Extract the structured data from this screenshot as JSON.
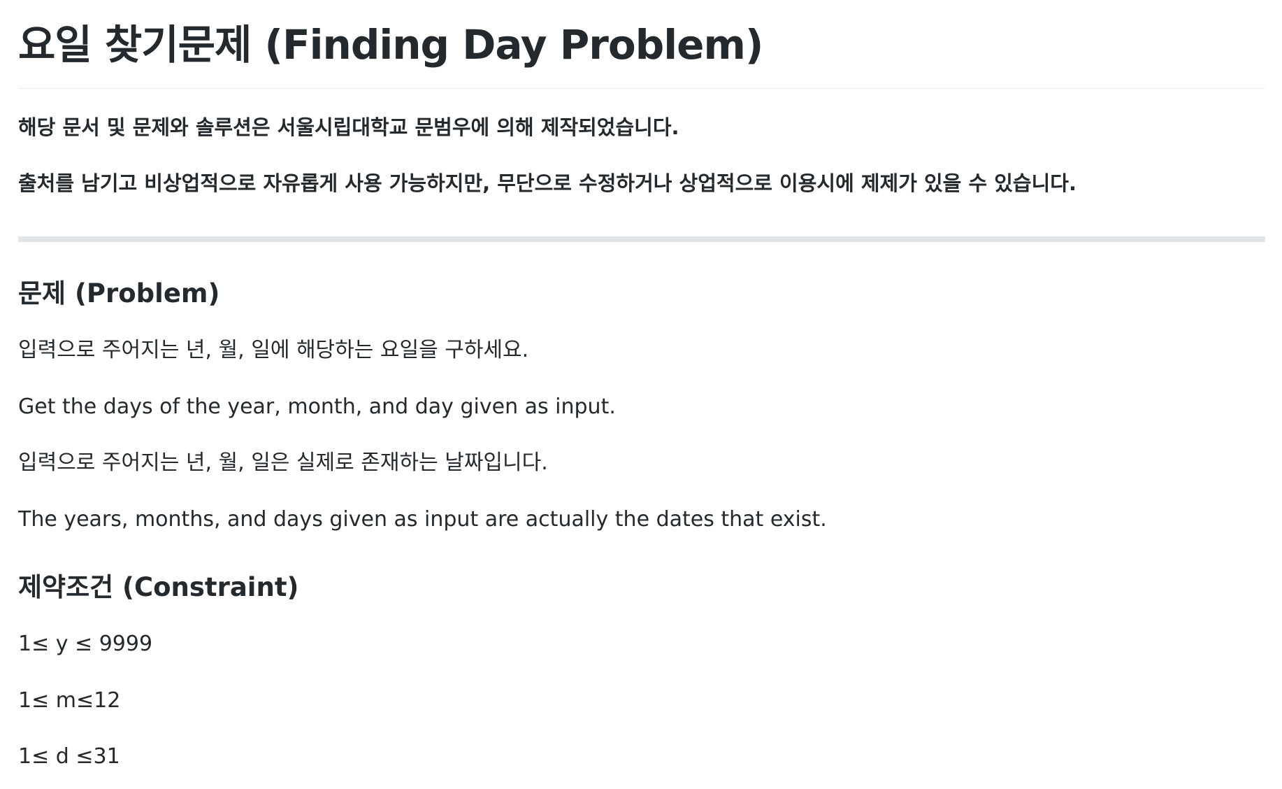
{
  "title": "요일 찾기문제 (Finding Day Problem)",
  "notice": {
    "line1": "해당 문서 및 문제와 솔루션은 서울시립대학교 문범우에 의해 제작되었습니다.",
    "line2": "출처를 남기고 비상업적으로 자유롭게 사용 가능하지만, 무단으로 수정하거나 상업적으로 이용시에 제제가 있을 수 있습니다."
  },
  "problem": {
    "heading": "문제 (Problem)",
    "lines": [
      "입력으로 주어지는 년, 월, 일에 해당하는 요일을 구하세요.",
      "Get the days of the year, month, and day given as input.",
      "입력으로 주어지는 년, 월, 일은 실제로 존재하는 날짜입니다.",
      "The years, months, and days given as input are actually the dates that exist."
    ]
  },
  "constraint": {
    "heading": "제약조건 (Constraint)",
    "lines": [
      "1≤ y ≤ 9999",
      "1≤ m≤12",
      "1≤ d ≤31"
    ]
  }
}
